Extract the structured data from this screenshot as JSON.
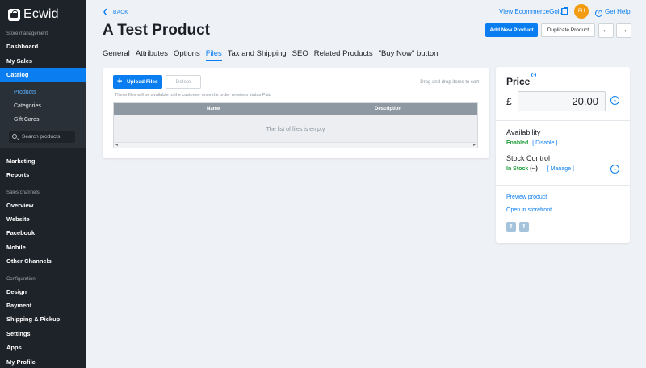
{
  "app": {
    "logo_text": "Ecwid"
  },
  "sidebar": {
    "store_management": "Store management",
    "dashboard": "Dashboard",
    "my_sales": "My Sales",
    "catalog": "Catalog",
    "products": "Products",
    "categories": "Categories",
    "gift_cards": "Gift Cards",
    "search_placeholder": "Search products",
    "marketing": "Marketing",
    "reports": "Reports",
    "sales_channels": "Sales channels",
    "overview": "Overview",
    "website": "Website",
    "facebook": "Facebook",
    "mobile": "Mobile",
    "other_channels": "Other Channels",
    "configuration": "Configuration",
    "design": "Design",
    "payment": "Payment",
    "shipping": "Shipping & Pickup",
    "settings": "Settings",
    "apps": "Apps",
    "my_profile": "My Profile"
  },
  "header": {
    "back": "BACK",
    "title": "A Test Product",
    "view_store": "View EcommerceGold",
    "avatar_initials": "PH",
    "help": "Get Help",
    "add_new_product": "Add New Product",
    "duplicate_product": "Duplicate Product",
    "prev": "←",
    "next": "→"
  },
  "tabs": [
    {
      "label": "General"
    },
    {
      "label": "Attributes"
    },
    {
      "label": "Options"
    },
    {
      "label": "Files"
    },
    {
      "label": "Tax and Shipping"
    },
    {
      "label": "SEO"
    },
    {
      "label": "Related Products"
    },
    {
      "label": "\"Buy Now\" button"
    }
  ],
  "files": {
    "upload": "Upload Files",
    "delete": "Delete",
    "drag_hint": "Drag and drop items to sort",
    "note": "These files will be available to the customer once the order receives status Paid",
    "col_name": "Name",
    "col_description": "Description",
    "empty": "The list of files is empty"
  },
  "price_panel": {
    "title": "Price",
    "currency": "£",
    "price_value": "20.00",
    "availability_label": "Availability",
    "enabled": "Enabled",
    "disable_link": "[ Disable ]",
    "stock_label": "Stock Control",
    "in_stock": "In Stock",
    "stock_qty": "(∞)",
    "manage_link": "[ Manage ]",
    "preview_product": "Preview product",
    "open_storefront": "Open in storefront",
    "facebook_icon": "f",
    "twitter_icon": "t"
  },
  "colors": {
    "accent": "#0a7ef0",
    "sidebar_bg": "#1e2329",
    "enabled_green": "#1f9d3a"
  }
}
